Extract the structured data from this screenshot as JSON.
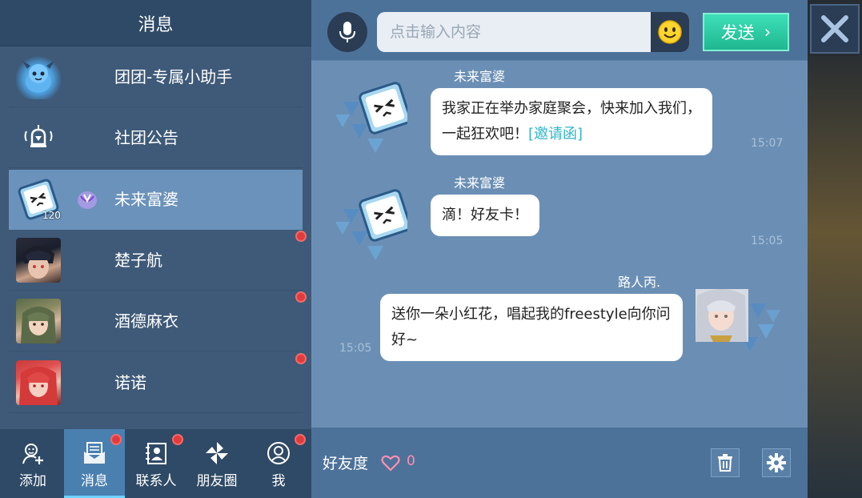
{
  "left_panel": {
    "title": "消息",
    "conversations": [
      {
        "name": "团团-专属小助手",
        "avatar": "dragon-mascot-avatar",
        "unread": false
      },
      {
        "name": "社团公告",
        "avatar": "bell-announcement-icon",
        "unread": false
      },
      {
        "name": "未来富婆",
        "avatar": "cube-face-avatar",
        "level": "120",
        "active": true,
        "unread": false
      },
      {
        "name": "楚子航",
        "avatar": "dark-hair-boy-avatar",
        "unread": true
      },
      {
        "name": "酒德麻衣",
        "avatar": "green-hair-girl-avatar",
        "unread": true
      },
      {
        "name": "诺诺",
        "avatar": "red-hair-girl-avatar",
        "unread": true
      }
    ]
  },
  "tabs": [
    {
      "label": "添加",
      "icon": "add-friend-icon",
      "badge": false
    },
    {
      "label": "消息",
      "icon": "message-envelope-icon",
      "badge": true,
      "active": true
    },
    {
      "label": "联系人",
      "icon": "contacts-icon",
      "badge": true
    },
    {
      "label": "朋友圈",
      "icon": "pinwheel-icon",
      "badge": false
    },
    {
      "label": "我",
      "icon": "profile-face-icon",
      "badge": true
    }
  ],
  "chat": {
    "input_placeholder": "点击输入内容",
    "send_label": "发送",
    "send_arrow": "›",
    "messages": [
      {
        "sender": "未来富婆",
        "text": "我家正在举办家庭聚会，快来加入我们，一起狂欢吧！",
        "link": "[邀请函]",
        "time": "15:07",
        "side": "left"
      },
      {
        "sender": "未来富婆",
        "text": "滴！好友卡！",
        "time": "15:05",
        "side": "left"
      },
      {
        "sender": "路人丙.",
        "text": "送你一朵小红花，唱起我的freestyle向你问好~",
        "time": "15:05",
        "side": "right"
      }
    ],
    "footer": {
      "friendship_label": "好友度",
      "friendship_value": "0"
    }
  },
  "colors": {
    "accent_green": "#1fb78f",
    "badge_red": "#e23b3b",
    "link_teal": "#2fb5c8",
    "panel_blue": "#6b8fb4"
  }
}
